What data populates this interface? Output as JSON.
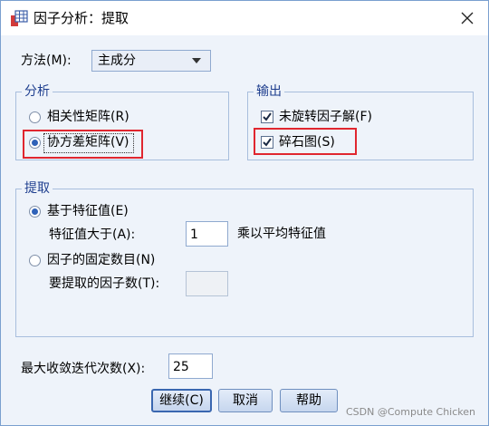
{
  "window": {
    "title": "因子分析：提取"
  },
  "method": {
    "label": "方法(M):",
    "value": "主成分"
  },
  "analyze": {
    "title": "分析",
    "options": [
      {
        "label": "相关性矩阵(R)",
        "selected": false
      },
      {
        "label": "协方差矩阵(V)",
        "selected": true
      }
    ]
  },
  "output": {
    "title": "输出",
    "options": [
      {
        "label": "未旋转因子解(F)",
        "checked": true
      },
      {
        "label": "碎石图(S)",
        "checked": true
      }
    ]
  },
  "extract": {
    "title": "提取",
    "eigen_option": {
      "label": "基于特征值(E)",
      "selected": true
    },
    "eigen_greater_label": "特征值大于(A):",
    "eigen_value": "1",
    "eigen_suffix": "乘以平均特征值",
    "fixed_option": {
      "label": "因子的固定数目(N)",
      "selected": false
    },
    "fixed_count_label": "要提取的因子数(T):",
    "fixed_count_value": ""
  },
  "iterations": {
    "label": "最大收敛迭代次数(X):",
    "value": "25"
  },
  "buttons": {
    "continue": "继续(C)",
    "cancel": "取消",
    "help": "帮助"
  },
  "watermark": "CSDN @Compute Chicken",
  "colors": {
    "highlight": "#e0262f",
    "group_title": "#1f3f8f",
    "radio_dot": "#2f62b8"
  }
}
